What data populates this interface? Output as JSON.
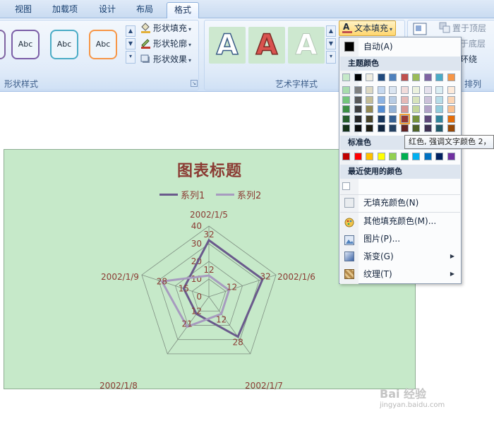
{
  "tabs": [
    {
      "label": "视图",
      "active": false
    },
    {
      "label": "加载项",
      "active": false
    },
    {
      "label": "设计",
      "active": false
    },
    {
      "label": "布局",
      "active": false
    },
    {
      "label": "格式",
      "active": true
    }
  ],
  "shape_styles_group": {
    "label": "形状样式",
    "gallery": [
      "Abc",
      "Abc",
      "Abc"
    ],
    "gallery_colors": [
      "#7b5ea7",
      "#4bacc6",
      "#f79646"
    ],
    "commands": [
      {
        "label": "形状填充",
        "icon": "paint-bucket-icon"
      },
      {
        "label": "形状轮廓",
        "icon": "pen-outline-icon"
      },
      {
        "label": "形状效果",
        "icon": "shape-effects-icon"
      }
    ]
  },
  "wordart_group": {
    "label": "艺术字样式",
    "gallery": [
      "A",
      "A",
      "A"
    ],
    "text_fill_label": "文本填充"
  },
  "arrange_group": {
    "label": "排列",
    "commands": [
      "置于顶层",
      "置于底层",
      "字环绕"
    ]
  },
  "color_menu": {
    "automatic": "自动(A)",
    "theme_colors_heading": "主题颜色",
    "theme_top_row": [
      "#c6e9c9",
      "#000000",
      "#eeece1",
      "#1f497d",
      "#4f81bd",
      "#c0504d",
      "#9bbb59",
      "#8064a2",
      "#4bacc6",
      "#f79646"
    ],
    "theme_shades": [
      [
        "#a7dcac",
        "#7f7f7f",
        "#ddd9c3",
        "#c6d9f0",
        "#dbe5f1",
        "#f2dcdb",
        "#ebf1dd",
        "#e5e0ec",
        "#dbeef3",
        "#fdeada"
      ],
      [
        "#73c57b",
        "#595959",
        "#c4bd97",
        "#8db3e2",
        "#b8cce4",
        "#e5b9b7",
        "#d7e3bc",
        "#ccc1d9",
        "#b7dde8",
        "#fbd5b5"
      ],
      [
        "#3c8f44",
        "#3f3f3f",
        "#938953",
        "#548dd4",
        "#95b3d7",
        "#d99694",
        "#c3d69b",
        "#b2a2c7",
        "#92cddc",
        "#fac08f"
      ],
      [
        "#275e2c",
        "#262626",
        "#494429",
        "#17365d",
        "#366092",
        "#953734",
        "#76923c",
        "#5f497a",
        "#31859b",
        "#e36c09"
      ],
      [
        "#143017",
        "#0c0c0c",
        "#1d1b10",
        "#0f243e",
        "#244061",
        "#632423",
        "#4f6128",
        "#3f3151",
        "#205867",
        "#974806"
      ]
    ],
    "highlighted_swatch": {
      "row": 3,
      "col": 5
    },
    "standard_colors_heading": "标准色",
    "standard_colors": [
      "#c00000",
      "#ff0000",
      "#ffc000",
      "#ffff00",
      "#92d050",
      "#00b050",
      "#00b0f0",
      "#0070c0",
      "#002060",
      "#7030a0"
    ],
    "recent_colors_heading": "最近使用的颜色",
    "recent_colors": [
      "#ffffff"
    ],
    "items": [
      {
        "label": "无填充颜色(N)",
        "icon": "no-fill-icon",
        "submenu": false
      },
      {
        "label": "其他填充颜色(M)...",
        "icon": "color-palette-icon",
        "submenu": false
      },
      {
        "label": "图片(P)...",
        "icon": "picture-icon",
        "submenu": false
      },
      {
        "label": "渐变(G)",
        "icon": "gradient-icon",
        "submenu": true
      },
      {
        "label": "纹理(T)",
        "icon": "texture-icon",
        "submenu": true
      }
    ]
  },
  "tooltip": "红色, 强调文字颜色 2，",
  "chart": {
    "title": "图表标题",
    "background": "#c6e9c9",
    "title_color": "#8b3b33"
  },
  "chart_data": {
    "type": "radar",
    "categories": [
      "2002/1/5",
      "2002/1/6",
      "2002/1/7",
      "2002/1/8",
      "2002/1/9"
    ],
    "series": [
      {
        "name": "系列1",
        "color": "#6a5a8c",
        "values": [
          32,
          32,
          28,
          12,
          15
        ]
      },
      {
        "name": "系列2",
        "color": "#a79bbf",
        "values": [
          12,
          12,
          12,
          21,
          28
        ]
      }
    ],
    "rlim": [
      0,
      40
    ],
    "radial_ticks": [
      0,
      10,
      20,
      30,
      40
    ],
    "grid": true
  },
  "watermark": {
    "brand": "Bai 经验",
    "url": "jingyan.baidu.com"
  }
}
